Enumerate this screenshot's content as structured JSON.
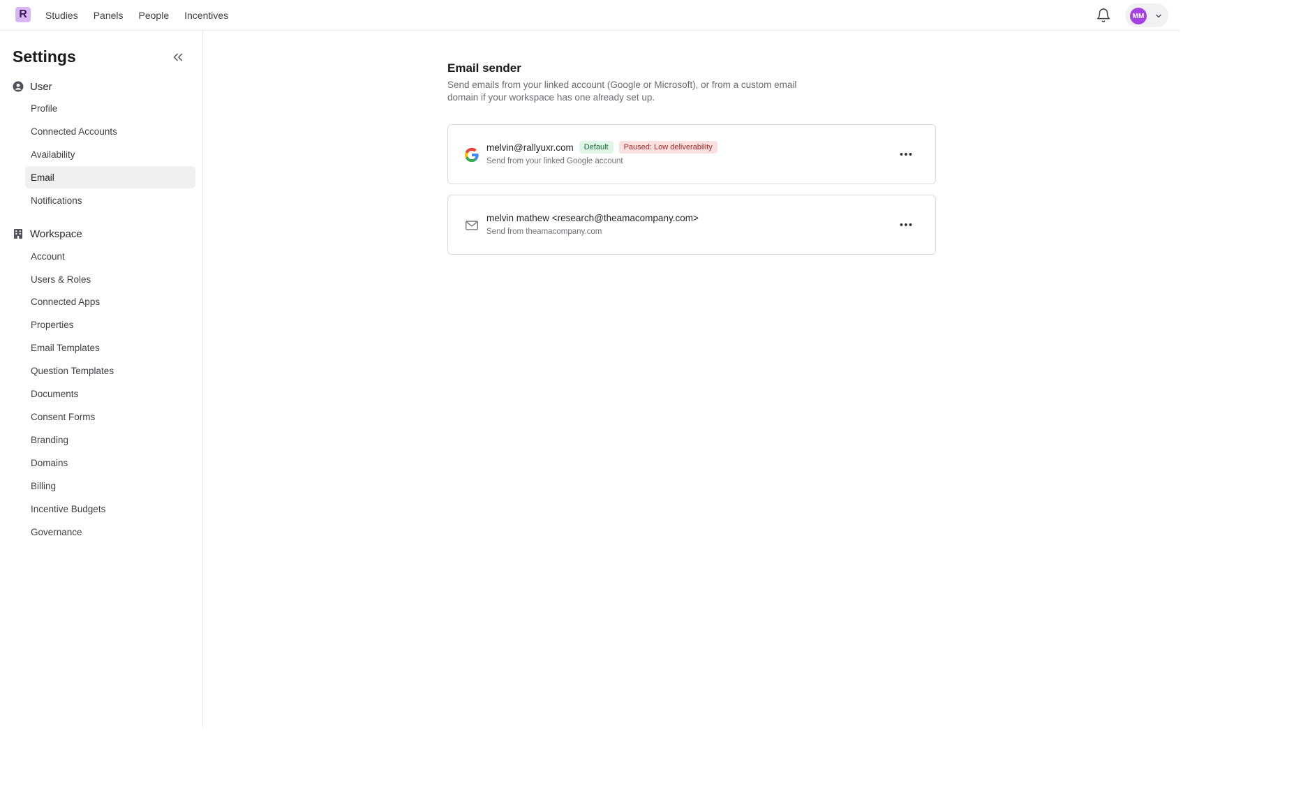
{
  "header": {
    "logo_letter": "R",
    "nav": [
      "Studies",
      "Panels",
      "People",
      "Incentives"
    ],
    "avatar_initials": "MM"
  },
  "sidebar": {
    "title": "Settings",
    "user_section": {
      "label": "User",
      "items": [
        "Profile",
        "Connected Accounts",
        "Availability",
        "Email",
        "Notifications"
      ]
    },
    "workspace_section": {
      "label": "Workspace",
      "items": [
        "Account",
        "Users & Roles",
        "Connected Apps",
        "Properties",
        "Email Templates",
        "Question Templates",
        "Documents",
        "Consent Forms",
        "Branding",
        "Domains",
        "Billing",
        "Incentive Budgets",
        "Governance"
      ]
    },
    "active_item": "Email"
  },
  "main": {
    "title": "Email sender",
    "description": "Send emails from your linked account (Google or Microsoft), or from a custom email domain if your workspace has one already set up.",
    "senders": [
      {
        "icon": "google-icon",
        "address": "melvin@rallyuxr.com",
        "badge_default": "Default",
        "badge_status": "Paused: Low deliverability",
        "subtitle": "Send from your linked Google account"
      },
      {
        "icon": "mail-icon",
        "address": "melvin mathew <research@theamacompany.com>",
        "subtitle": "Send from theamacompany.com"
      }
    ]
  },
  "colors": {
    "avatar": "#a541e3",
    "logo": "#d7b8f5",
    "badge_default_bg": "#dff5e6",
    "badge_paused_bg": "#fbe0e0"
  }
}
